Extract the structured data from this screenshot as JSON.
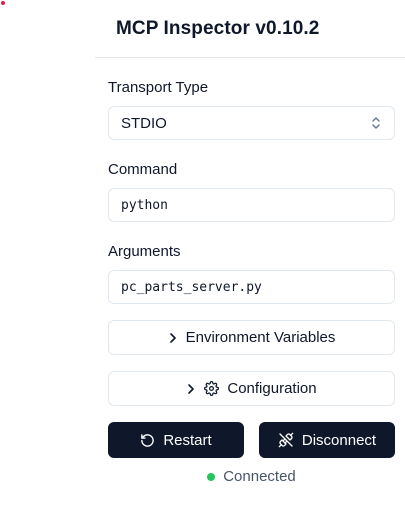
{
  "app": {
    "title": "MCP Inspector v0.10.2"
  },
  "transport": {
    "label": "Transport Type",
    "selected": "STDIO"
  },
  "command": {
    "label": "Command",
    "value": "python"
  },
  "arguments": {
    "label": "Arguments",
    "value": "pc_parts_server.py"
  },
  "sections": {
    "env_label": "Environment Variables",
    "config_label": "Configuration"
  },
  "actions": {
    "restart_label": "Restart",
    "disconnect_label": "Disconnect"
  },
  "status": {
    "text": "Connected",
    "color": "#22c55e"
  },
  "icons": {
    "select": "chevrons-up-down-icon",
    "env": "chevron-right-icon",
    "config_chevron": "chevron-right-icon",
    "config": "gear-icon",
    "restart": "rotate-ccw-icon",
    "disconnect": "unplug-icon"
  },
  "colors": {
    "primary": "#0f172a",
    "border": "#e2e8f0",
    "connected": "#22c55e"
  }
}
